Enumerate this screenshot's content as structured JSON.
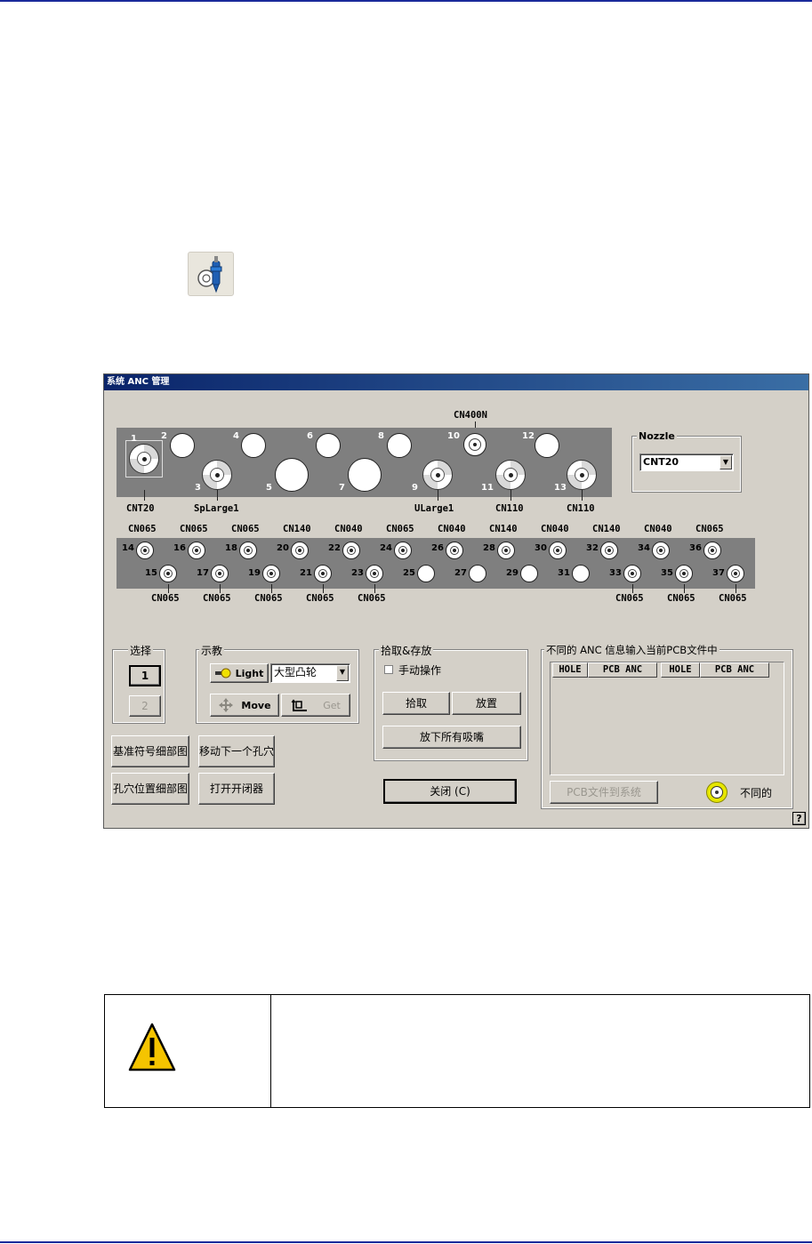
{
  "dialog": {
    "title": "系统 ANC 管理",
    "top_station_label": "CN400N",
    "top_nozzles": [
      {
        "num": "1",
        "label": "CNT20"
      },
      {
        "num": "2"
      },
      {
        "num": "3",
        "label": "SpLarge1"
      },
      {
        "num": "4"
      },
      {
        "num": "5"
      },
      {
        "num": "6"
      },
      {
        "num": "7"
      },
      {
        "num": "8"
      },
      {
        "num": "9",
        "label": "ULarge1"
      },
      {
        "num": "10"
      },
      {
        "num": "11",
        "label": "CN110"
      },
      {
        "num": "12"
      },
      {
        "num": "13",
        "label": "CN110"
      }
    ],
    "upper_row_labels": [
      "CN065",
      "CN065",
      "CN065",
      "CN140",
      "CN040",
      "CN065",
      "CN040",
      "CN140",
      "CN040",
      "CN140",
      "CN040",
      "CN065"
    ],
    "upper_row_nums": [
      "14",
      "16",
      "18",
      "20",
      "22",
      "24",
      "26",
      "28",
      "30",
      "32",
      "34",
      "36"
    ],
    "lower_row_nums": [
      "15",
      "17",
      "19",
      "21",
      "23",
      "25",
      "27",
      "29",
      "31",
      "33",
      "35",
      "37"
    ],
    "lower_row_labels": [
      "CN065",
      "CN065",
      "CN065",
      "CN065",
      "CN065",
      "",
      "",
      "",
      "",
      "CN065",
      "CN065",
      "CN065"
    ],
    "nozzle_group": {
      "title": "Nozzle",
      "value": "CNT20"
    },
    "select_group": {
      "title": "选择",
      "btn1": "1",
      "btn2": "2"
    },
    "teach_group": {
      "title": "示教",
      "light": "Light",
      "combo": "大型凸轮",
      "move": "Move",
      "get": "Get"
    },
    "pick_group": {
      "title": "拾取&存放",
      "manual": "手动操作",
      "pick": "拾取",
      "place": "放置",
      "release_all": "放下所有吸嘴"
    },
    "buttons": {
      "fiducial_detail": "基准符号细部图",
      "move_next_hole": "移动下一个孔穴",
      "hole_position_detail": "孔穴位置细部图",
      "open_opener": "打开开闭器",
      "close": "关闭 (C)",
      "pcb_to_system": "PCB文件到系统",
      "help": "?"
    },
    "anc_group": {
      "title": "不同的 ANC 信息输入当前PCB文件中",
      "columns": [
        "HOLE",
        "PCB ANC",
        "HOLE",
        "PCB ANC"
      ],
      "legend": "不同的"
    }
  },
  "colors": {
    "title_bar": "#0a246a",
    "dialog_bg": "#d4d0c8",
    "panel": "#7f7f7f",
    "legend_ring": "#e6e600",
    "rule": "#1a2a9a"
  },
  "icons": [
    "nozzle-tool-icon",
    "warning-icon"
  ]
}
